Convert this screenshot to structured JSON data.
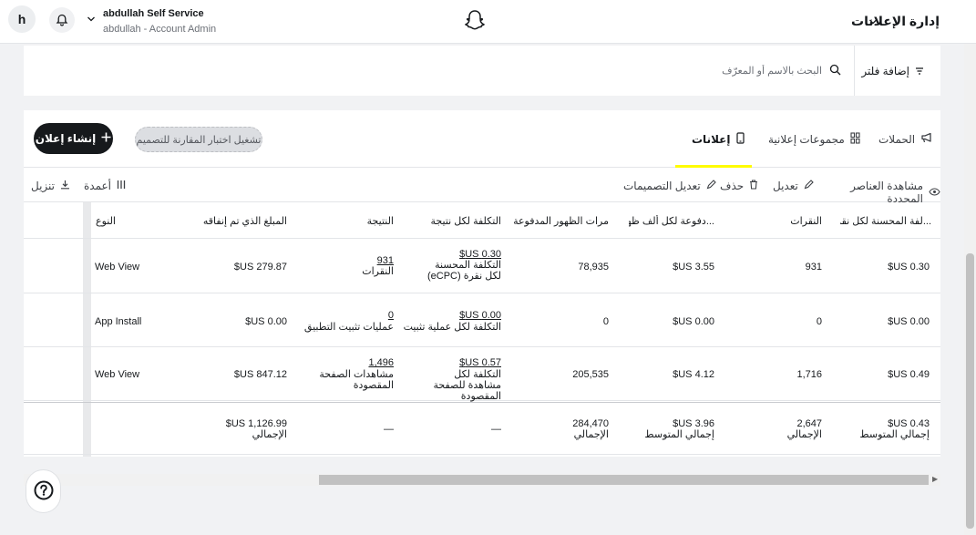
{
  "topbar": {
    "avatar_letter": "h",
    "account_name": "abdullah Self Service",
    "account_sub": "abdullah - Account Admin",
    "ads_manager_label": "إدارة الإعلانات"
  },
  "filterbar": {
    "add_filter_label": "إضافة فلتر",
    "search_placeholder": "البحث بالاسم أو المعرّف"
  },
  "tabs": {
    "campaigns": "الحملات",
    "ad_sets": "مجموعات إعلانية",
    "ads": "إعلانات",
    "active": "ads"
  },
  "buttons": {
    "create_ad": "إنشاء إعلان",
    "ab_test": "تشغيل اختبار المقارنة للتصميم"
  },
  "actions": {
    "view_selected": "مشاهدة العناصر المحددة",
    "edit": "تعديل",
    "delete": "حذف",
    "edit_creatives": "تعديل التصميمات",
    "columns": "أعمدة",
    "download": "تنزيل"
  },
  "table": {
    "headers": {
      "ecpc": "...لفة المحسنة لكل نقرة",
      "swipes": "النقرات",
      "ecpm": "...دفوعة لكل ألف ظهور",
      "impressions": "مرات الظهور المدفوعة",
      "cost_per_result": "التكلفة لكل نتيجة",
      "result": "النتيجة",
      "spend": "المبلغ الذي تم إنفاقه",
      "type": "النوع"
    },
    "rows": [
      {
        "ecpc": "0.30 US$",
        "swipes": "931",
        "ecpm": "3.55 US$",
        "impressions": "78,935",
        "cpr_value": "0.30 US$",
        "cpr_label": "التكلفة المحسنة لكل نقرة (eCPC)",
        "result_value": "931",
        "result_label": "النقرات",
        "spend": "279.87 US$",
        "type": "Web View"
      },
      {
        "ecpc": "0.00 US$",
        "swipes": "0",
        "ecpm": "0.00 US$",
        "impressions": "0",
        "cpr_value": "0.00 US$",
        "cpr_label": "التكلفة لكل عملية تثبيت",
        "result_value": "0",
        "result_label": "عمليات تثبيت التطبيق",
        "spend": "0.00 US$",
        "type": "App Install"
      },
      {
        "ecpc": "0.49 US$",
        "swipes": "1,716",
        "ecpm": "4.12 US$",
        "impressions": "205,535",
        "cpr_value": "0.57 US$",
        "cpr_label": "التكلفة لكل مشاهدة للصفحة المقصودة",
        "result_value": "1,496",
        "result_label": "مشاهدات الصفحة المقصودة",
        "spend": "847.12 US$",
        "type": "Web View"
      }
    ],
    "total": {
      "ecpc": "0.43 US$",
      "ecpc_label": "إجمالي المتوسط",
      "swipes": "2,647",
      "swipes_label": "الإجمالي",
      "ecpm": "3.96 US$",
      "ecpm_label": "إجمالي المتوسط",
      "impressions": "284,470",
      "impressions_label": "الإجمالي",
      "cpr": "—",
      "result": "—",
      "spend": "1,126.99 US$",
      "spend_label": "الإجمالي"
    }
  }
}
